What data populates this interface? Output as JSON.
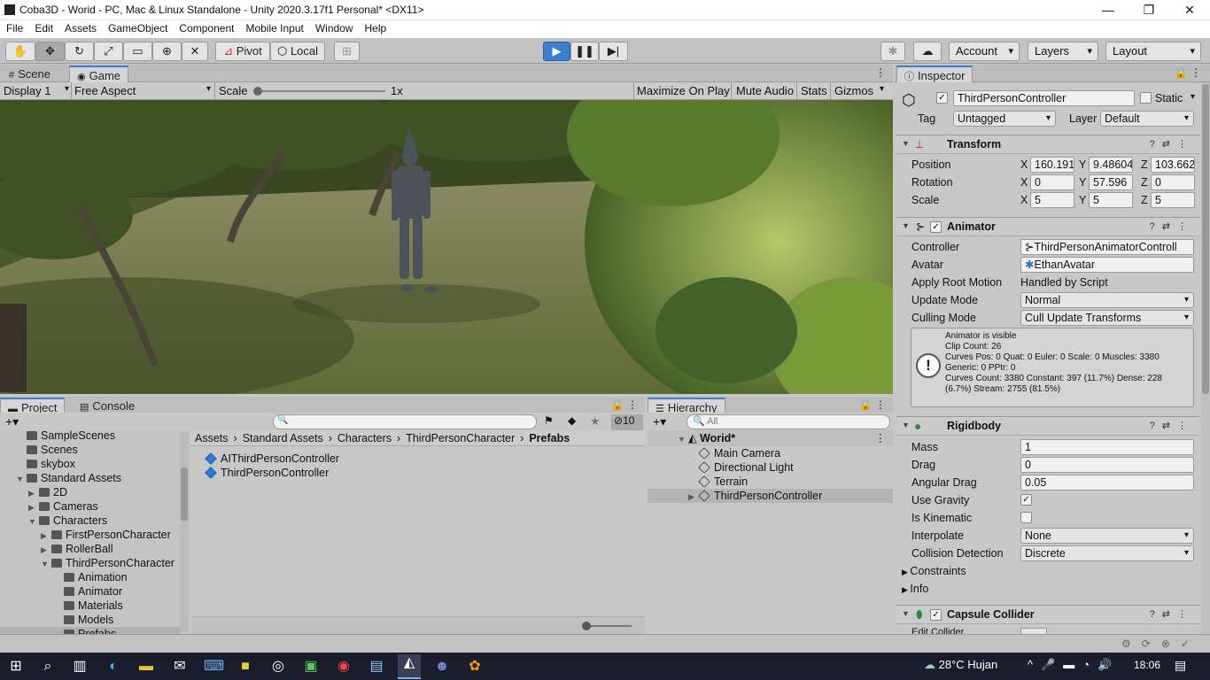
{
  "window": {
    "title": "Coba3D - Worid - PC, Mac & Linux Standalone - Unity 2020.3.17f1 Personal* <DX11>",
    "minimize": "—",
    "maximize": "❐",
    "close": "✕"
  },
  "menu": [
    "File",
    "Edit",
    "Assets",
    "GameObject",
    "Component",
    "Mobile Input",
    "Window",
    "Help"
  ],
  "toolbar": {
    "pivot": "Pivot",
    "local": "Local",
    "account": "Account",
    "layers": "Layers",
    "layout": "Layout"
  },
  "tabs": {
    "scene": "Scene",
    "game": "Game",
    "project": "Project",
    "console": "Console",
    "hierarchy": "Hierarchy",
    "inspector": "Inspector"
  },
  "game_bar": {
    "display": "Display 1",
    "aspect": "Free Aspect",
    "scale_label": "Scale",
    "scale_value": "1x",
    "maximize": "Maximize On Play",
    "mute": "Mute Audio",
    "stats": "Stats",
    "gizmos": "Gizmos"
  },
  "project": {
    "tree": [
      {
        "label": "SampleScenes",
        "indent": 0,
        "arrow": ""
      },
      {
        "label": "Scenes",
        "indent": 0,
        "arrow": ""
      },
      {
        "label": "skybox",
        "indent": 0,
        "arrow": ""
      },
      {
        "label": "Standard Assets",
        "indent": 0,
        "arrow": "▼"
      },
      {
        "label": "2D",
        "indent": 1,
        "arrow": "▶"
      },
      {
        "label": "Cameras",
        "indent": 1,
        "arrow": "▶"
      },
      {
        "label": "Characters",
        "indent": 1,
        "arrow": "▼"
      },
      {
        "label": "FirstPersonCharacter",
        "indent": 2,
        "arrow": "▶"
      },
      {
        "label": "RollerBall",
        "indent": 2,
        "arrow": "▶"
      },
      {
        "label": "ThirdPersonCharacter",
        "indent": 2,
        "arrow": "▼"
      },
      {
        "label": "Animation",
        "indent": 3,
        "arrow": ""
      },
      {
        "label": "Animator",
        "indent": 3,
        "arrow": ""
      },
      {
        "label": "Materials",
        "indent": 3,
        "arrow": ""
      },
      {
        "label": "Models",
        "indent": 3,
        "arrow": ""
      },
      {
        "label": "Prefabs",
        "indent": 3,
        "arrow": "",
        "selected": true
      }
    ],
    "breadcrumb": [
      "Assets",
      "Standard Assets",
      "Characters",
      "ThirdPersonCharacter",
      "Prefabs"
    ],
    "assets": [
      "AIThirdPersonController",
      "ThirdPersonController"
    ],
    "hidden_count": "10"
  },
  "hierarchy": {
    "search_placeholder": "All",
    "scene": "Worid*",
    "items": [
      {
        "label": "Main Camera",
        "arrow": ""
      },
      {
        "label": "Directional Light",
        "arrow": ""
      },
      {
        "label": "Terrain",
        "arrow": ""
      },
      {
        "label": "ThirdPersonController",
        "arrow": "▶",
        "selected": true
      }
    ]
  },
  "inspector": {
    "object_name": "ThirdPersonController",
    "static_label": "Static",
    "tag_label": "Tag",
    "tag_value": "Untagged",
    "layer_label": "Layer",
    "layer_value": "Default",
    "transform": {
      "title": "Transform",
      "rows": [
        {
          "label": "Position",
          "x": "160.191",
          "y": "9.48604",
          "z": "103.662"
        },
        {
          "label": "Rotation",
          "x": "0",
          "y": "57.596",
          "z": "0"
        },
        {
          "label": "Scale",
          "x": "5",
          "y": "5",
          "z": "5"
        }
      ]
    },
    "animator": {
      "title": "Animator",
      "controller_label": "Controller",
      "controller_value": "ThirdPersonAnimatorControll",
      "avatar_label": "Avatar",
      "avatar_value": "EthanAvatar",
      "root_label": "Apply Root Motion",
      "root_value": "Handled by Script",
      "update_label": "Update Mode",
      "update_value": "Normal",
      "culling_label": "Culling Mode",
      "culling_value": "Cull Update Transforms",
      "info": [
        "Animator is visible",
        "Clip Count: 26",
        "Curves Pos: 0 Quat: 0 Euler: 0 Scale: 0 Muscles: 3380",
        "Generic: 0 PPtr: 0",
        "Curves Count: 3380 Constant: 397 (11.7%) Dense: 228",
        "(6.7%) Stream: 2755 (81.5%)"
      ]
    },
    "rigidbody": {
      "title": "Rigidbody",
      "mass_label": "Mass",
      "mass": "1",
      "drag_label": "Drag",
      "drag": "0",
      "angular_label": "Angular Drag",
      "angular": "0.05",
      "gravity_label": "Use Gravity",
      "kinematic_label": "Is Kinematic",
      "interp_label": "Interpolate",
      "interp": "None",
      "coll_label": "Collision Detection",
      "coll": "Discrete",
      "constraints": "Constraints",
      "info": "Info"
    },
    "capsule": {
      "title": "Capsule Collider",
      "edit": "Edit Collider"
    }
  },
  "taskbar": {
    "weather": "28°C  Hujan",
    "time": "18:06"
  }
}
